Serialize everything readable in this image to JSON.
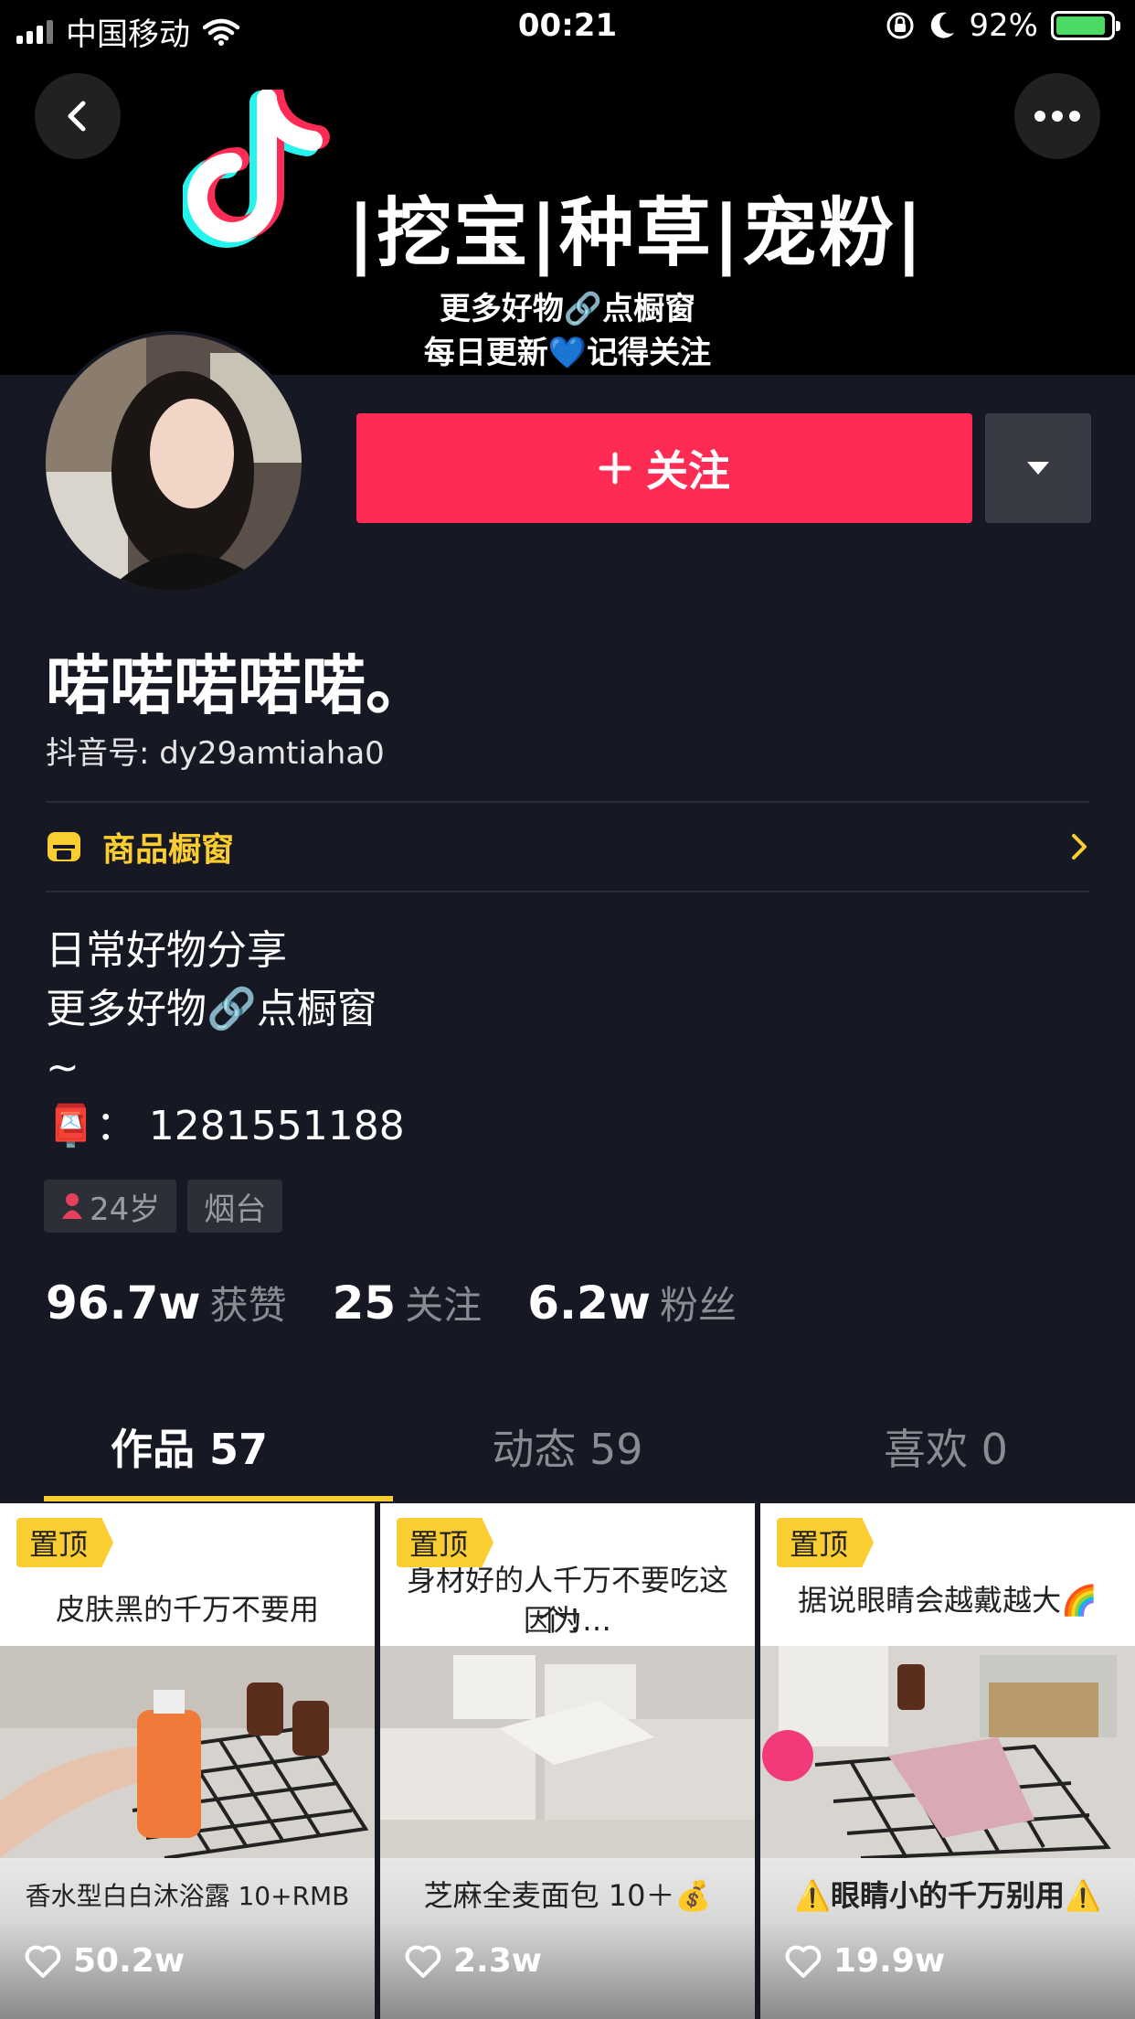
{
  "status_bar": {
    "carrier": "中国移动",
    "time": "00:21",
    "battery": "92%",
    "battery_level": 0.92
  },
  "banner": {
    "title": "|挖宝|种草|宠粉|",
    "line1": "更多好物🔗点橱窗",
    "line2": "每日更新💙记得关注"
  },
  "profile": {
    "follow_label": "关注",
    "name": "喏喏喏喏喏。",
    "douyin_id": "抖音号: dy29amtiaha0",
    "shop_label": "商品橱窗",
    "bio": [
      "日常好物分享",
      "更多好物🔗点橱窗",
      "~",
      "📮： 1281551188"
    ],
    "tags": {
      "age": "24岁",
      "location": "烟台"
    }
  },
  "stats": [
    {
      "value": "96.7w",
      "label": "获赞"
    },
    {
      "value": "25",
      "label": "关注"
    },
    {
      "value": "6.2w",
      "label": "粉丝"
    }
  ],
  "tabs": [
    {
      "label": "作品 57",
      "active": true
    },
    {
      "label": "动态 59",
      "active": false
    },
    {
      "label": "喜欢 0",
      "active": false
    }
  ],
  "videos": [
    {
      "pinned": "置顶",
      "caption_line1": "皮肤黑的千万不要用",
      "caption_line2": "",
      "subtitle": "香水型白白沐浴露  10+RMB",
      "likes": "50.2w"
    },
    {
      "pinned": "置顶",
      "caption_line1": "身材好的人千万不要吃这个！",
      "caption_line2": "因为…",
      "subtitle": "芝麻全麦面包  10＋💰",
      "likes": "2.3w"
    },
    {
      "pinned": "置顶",
      "caption_line1": "据说眼睛会越戴越大🌈",
      "caption_line2": "",
      "subtitle": "⚠️眼睛小的千万别用⚠️",
      "likes": "19.9w"
    }
  ],
  "colors": {
    "background": "#161823",
    "accent": "#fe2c55",
    "highlight": "#facd32"
  }
}
